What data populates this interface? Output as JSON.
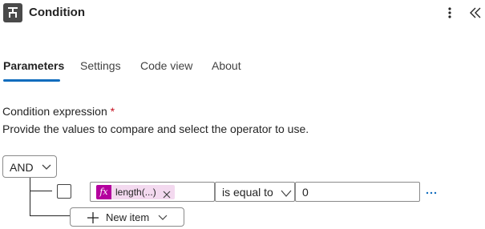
{
  "header": {
    "title": "Condition",
    "icon": "condition-icon",
    "more_icon": "more-vertical-icon",
    "collapse_icon": "double-chevron-left-icon"
  },
  "tabs": [
    {
      "label": "Parameters",
      "active": true
    },
    {
      "label": "Settings",
      "active": false
    },
    {
      "label": "Code view",
      "active": false
    },
    {
      "label": "About",
      "active": false
    }
  ],
  "condition": {
    "label": "Condition expression",
    "required_mark": "*",
    "description": "Provide the values to compare and select the operator to use.",
    "group_operator": "AND",
    "rows": [
      {
        "checked": false,
        "left_token": {
          "icon": "function-fx-icon",
          "icon_text": "fx",
          "text": "length(...)"
        },
        "operator": "is equal to",
        "right_value": "0"
      }
    ],
    "new_item_label": "New item"
  },
  "colors": {
    "accent": "#0f6cbd",
    "token_bg": "#f3d9ef",
    "token_icon_bg": "#b4009e",
    "required": "#c50f1f"
  }
}
